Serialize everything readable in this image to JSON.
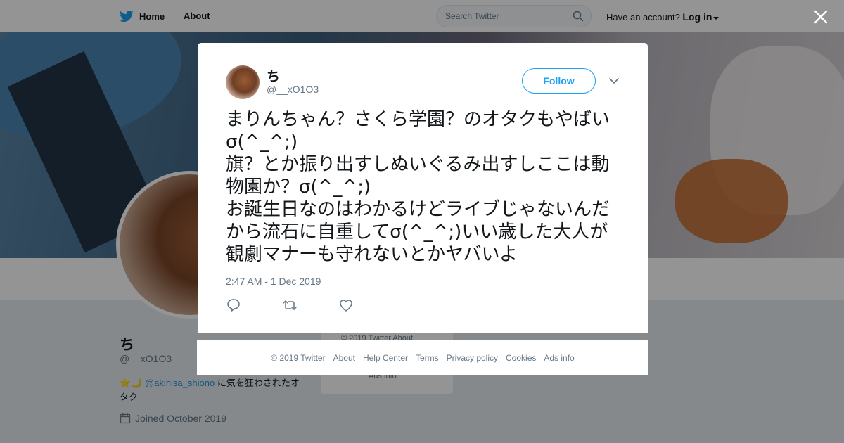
{
  "topbar": {
    "home_label": "Home",
    "about_label": "About",
    "search_placeholder": "Search Twitter",
    "account_prompt": "Have an account?",
    "login_label": "Log in"
  },
  "profile": {
    "name": "ち",
    "handle": "@__xO1O3",
    "bio_emoji": "⭐️🌙",
    "bio_mention": "@akihisa_shiono",
    "bio_rest": " に気を狂わされたオタク",
    "joined": "Joined October 2019"
  },
  "side_card": {
    "line": "© 2019 Twitter   About",
    "ads": "Ads info"
  },
  "tweet": {
    "author_name": "ち",
    "author_handle": "@__xO1O3",
    "follow_label": "Follow",
    "text": "まりんちゃん？さくら学園？のオタクもやばいσ(^_^;)\n旗？とか振り出すしぬいぐるみ出すしここは動物園か？σ(^_^;)\nお誕生日なのはわかるけどライブじゃないんだから流石に自重してσ(^_^;)いい歳した大人が観劇マナーも守れないとかヤバいよ",
    "timestamp": "2:47 AM - 1 Dec 2019"
  },
  "footer": {
    "links": [
      "© 2019 Twitter",
      "About",
      "Help Center",
      "Terms",
      "Privacy policy",
      "Cookies",
      "Ads info"
    ]
  },
  "icons": {
    "twitter_bird": "bird-icon",
    "search": "search-icon",
    "close": "close-icon",
    "caret": "chevron-down-icon",
    "reply": "reply-icon",
    "retweet": "retweet-icon",
    "like": "heart-icon",
    "calendar": "calendar-icon"
  },
  "colors": {
    "accent": "#1da1f2",
    "text_secondary": "#657786",
    "link": "#1b95e0"
  }
}
